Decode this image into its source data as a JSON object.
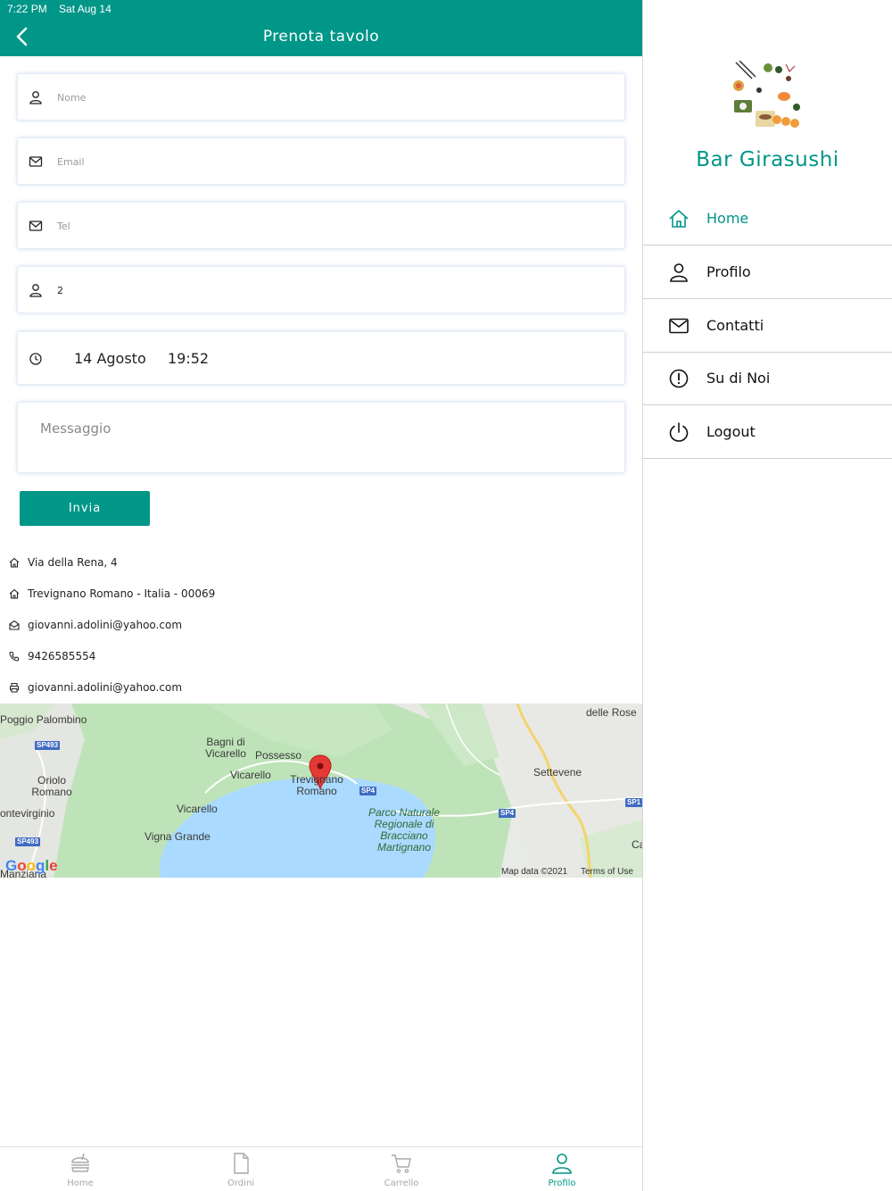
{
  "status_bar": {
    "time": "7:22 PM",
    "date": "Sat Aug 14"
  },
  "header": {
    "title": "Prenota tavolo"
  },
  "form": {
    "nome_placeholder": "Nome",
    "email_placeholder": "Email",
    "tel_placeholder": "Tel",
    "persone_value": "2",
    "date_value": "14 Agosto",
    "time_value": "19:52",
    "messaggio_placeholder": "Messaggio",
    "submit_label": "Invia"
  },
  "info": {
    "address": "Via della Rena, 4",
    "city": "Trevignano Romano - Italia - 00069",
    "email": "giovanni.adolini@yahoo.com",
    "phone": "9426585554",
    "fax": "giovanni.adolini@yahoo.com"
  },
  "map": {
    "labels": {
      "poggio": "Poggio Palombino",
      "oriolo": "Oriolo Romano",
      "montevirginio": "ontevirginio",
      "bagni": "Bagni di Vicarello",
      "possesso": "Possesso",
      "vicarello1": "Vicarello",
      "trevignano": "Trevignano Romano",
      "vicarello2": "Vicarello",
      "vigna": "Vigna Grande",
      "parco": "Parco Naturale Regionale di Bracciano Martignano",
      "settevene": "Settevene",
      "rose": "delle Rose",
      "manziana": "Manziana",
      "ca": "Ca"
    },
    "roads": {
      "sp493a": "SP493",
      "sp493b": "SP493",
      "sp4a": "SP4",
      "sp4b": "SP4",
      "sp1": "SP1"
    },
    "attribution": {
      "google": "Google",
      "map_data": "Map data ©2021",
      "terms": "Terms of Use"
    }
  },
  "tabs": [
    {
      "label": "Home",
      "icon": "burger-icon"
    },
    {
      "label": "Ordini",
      "icon": "document-icon"
    },
    {
      "label": "Carrello",
      "icon": "cart-icon"
    },
    {
      "label": "Profilo",
      "icon": "user-icon"
    }
  ],
  "sidebar": {
    "brand": "Bar Girasushi",
    "items": [
      {
        "label": "Home",
        "icon": "home-icon"
      },
      {
        "label": "Profilo",
        "icon": "user-icon"
      },
      {
        "label": "Contatti",
        "icon": "mail-icon"
      },
      {
        "label": "Su di Noi",
        "icon": "info-icon"
      },
      {
        "label": "Logout",
        "icon": "power-icon"
      }
    ]
  },
  "colors": {
    "accent": "#009688",
    "active_tab": "#009688"
  }
}
